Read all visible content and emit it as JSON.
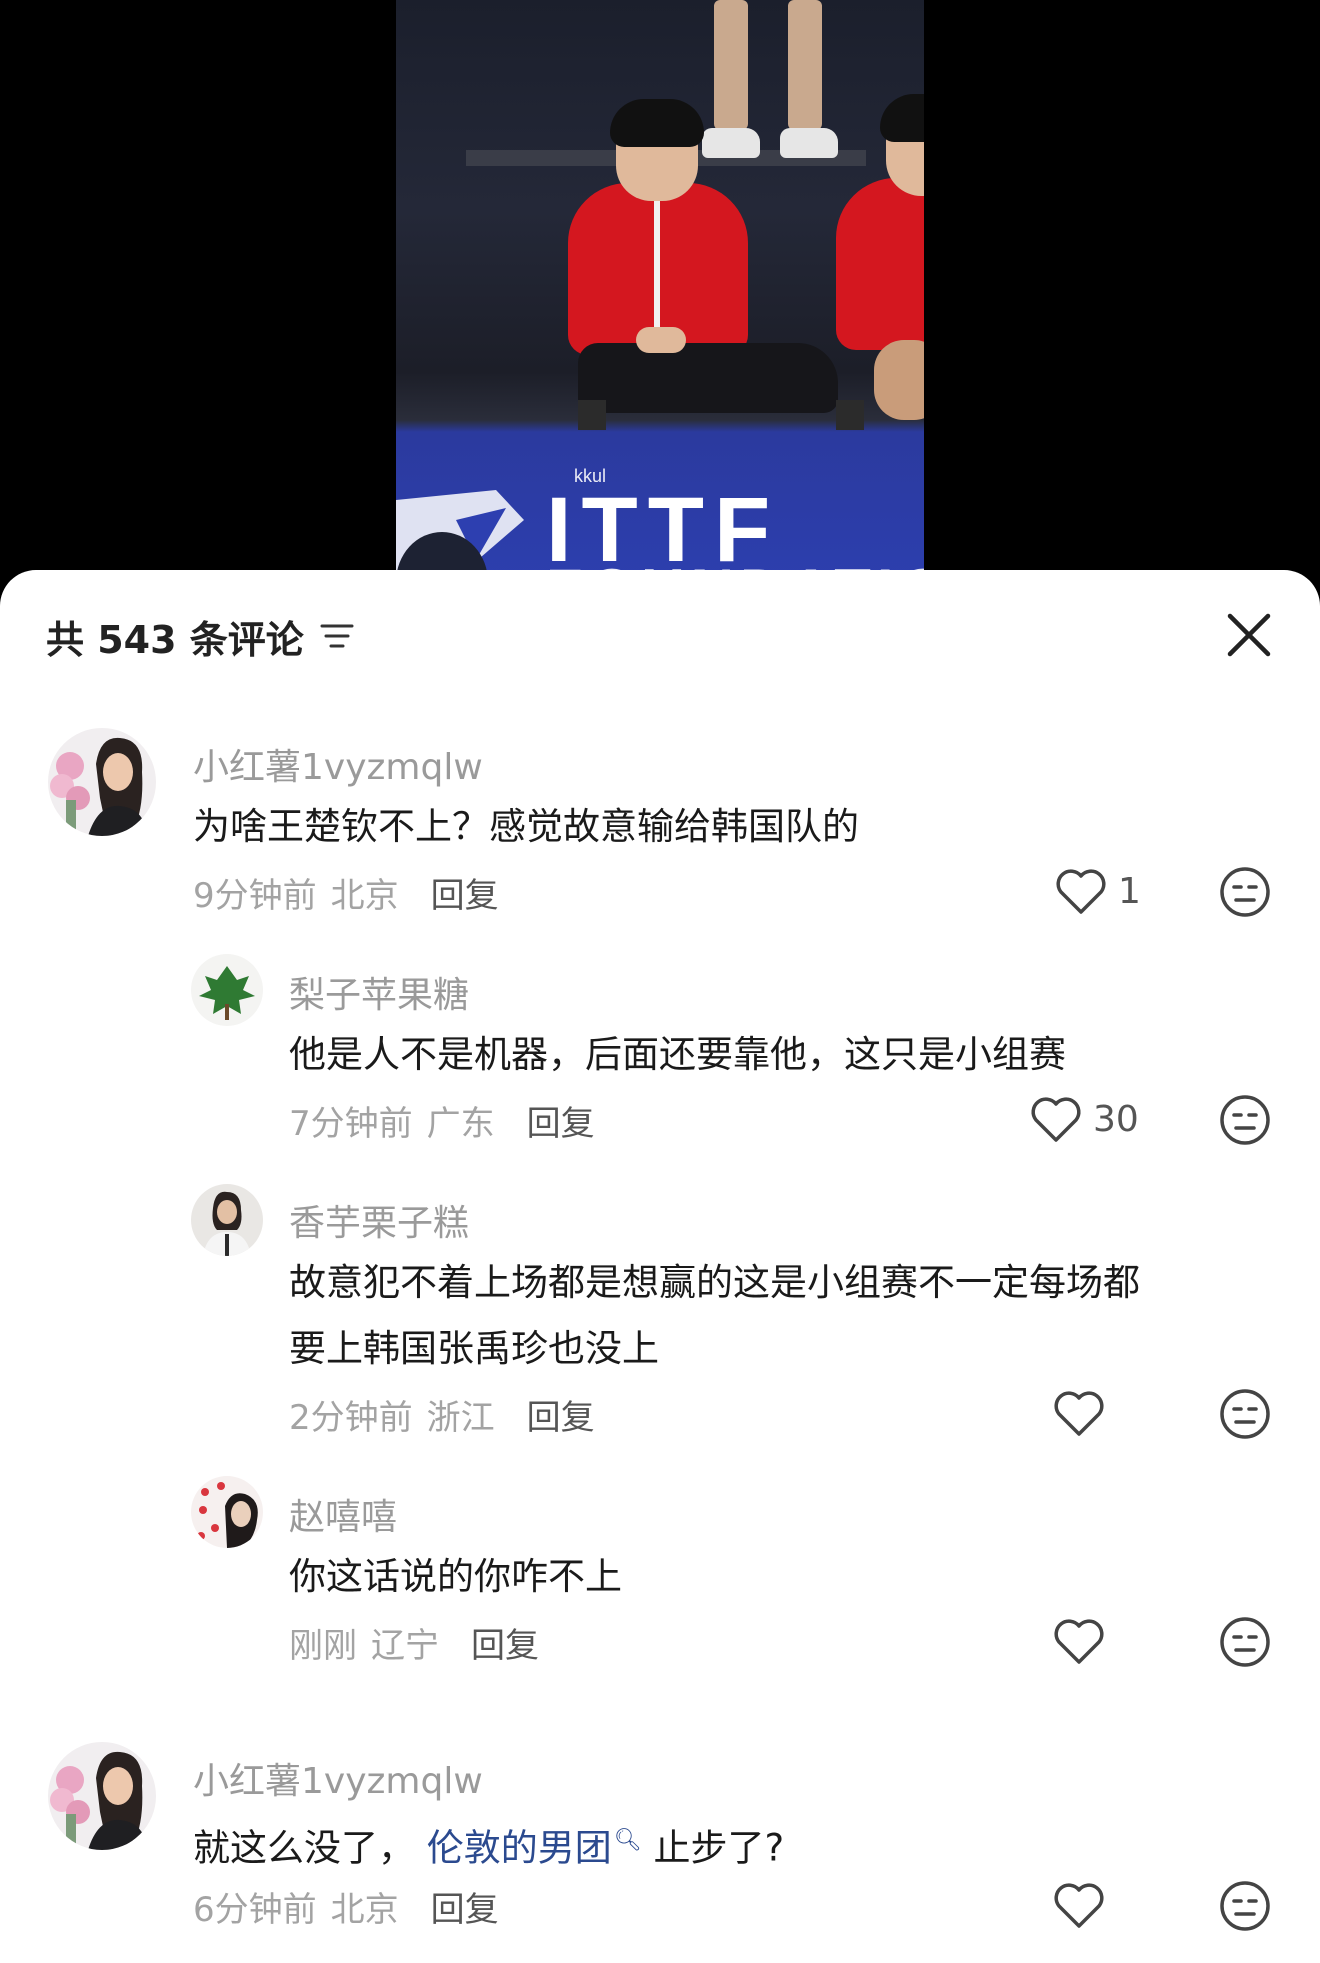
{
  "video": {
    "watermark": "kkul",
    "banner_text": "ITTF",
    "banner_subtext": "FOUNDATION"
  },
  "comments_panel": {
    "count_label": "共 543 条评论",
    "comments": [
      {
        "username": "小红薯1vyzmqlw",
        "content": "为啥王楚钦不上？感觉故意输给韩国队的",
        "time": "9分钟前",
        "location": "北京",
        "reply_label": "回复",
        "likes": "1",
        "replies": [
          {
            "username": "梨子苹果糖",
            "content": "他是人不是机器，后面还要靠他，这只是小组赛",
            "time": "7分钟前",
            "location": "广东",
            "reply_label": "回复",
            "likes": "30"
          },
          {
            "username": "香芋栗子糕",
            "content_line1": "故意犯不着上场都是想赢的这是小组赛不一定每场都",
            "content_line2": "要上韩国张禹珍也没上",
            "time": "2分钟前",
            "location": "浙江",
            "reply_label": "回复",
            "likes": ""
          },
          {
            "username": "赵嘻嘻",
            "content": "你这话说的你咋不上",
            "time": "刚刚",
            "location": "辽宁",
            "reply_label": "回复",
            "likes": ""
          }
        ]
      },
      {
        "username": "小红薯1vyzmqlw",
        "content_before": "就这么没了，",
        "mention": "伦敦的男团",
        "content_after": "止步了?",
        "time": "6分钟前",
        "location": "北京",
        "reply_label": "回复"
      }
    ]
  },
  "icons": {
    "filter": "filter-icon",
    "close": "close-icon",
    "like": "heart-outline-icon",
    "dislike": "meh-face-icon",
    "search_mention": "search-icon"
  },
  "colors": {
    "panel_bg": "#ffffff",
    "mention_link": "#2b4a8f",
    "meta_text": "#a3a3a3",
    "username_text": "#9a9a9a",
    "jacket_red": "#d4171f",
    "banner_blue": "#2d3fb0"
  }
}
